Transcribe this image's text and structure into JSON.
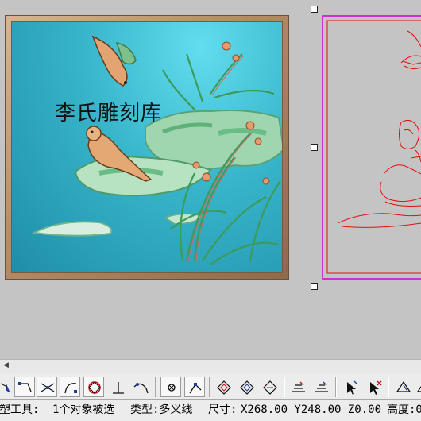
{
  "canvas": {
    "watermark": "李氏雕刻库"
  },
  "toolbar": {
    "tools": [
      {
        "name": "partial-arrow-tool",
        "icon": "arrow-icon"
      },
      {
        "name": "polyline-tool",
        "icon": "polyline-icon"
      },
      {
        "name": "trim-tool",
        "icon": "cross-lines-icon"
      },
      {
        "name": "arc-tool",
        "icon": "arc-icon"
      },
      {
        "name": "circle-tool",
        "icon": "circle-diamond-icon"
      },
      {
        "name": "perpendicular-tool",
        "icon": "perpendicular-icon"
      },
      {
        "name": "curve-tool",
        "icon": "curve-icon"
      },
      {
        "name": "node-tool",
        "icon": "node-box-icon"
      },
      {
        "name": "vertex-tool",
        "icon": "vertex-icon"
      },
      {
        "name": "offset-tool-1",
        "icon": "diamond-icon"
      },
      {
        "name": "offset-tool-2",
        "icon": "diamond-icon"
      },
      {
        "name": "offset-tool-3",
        "icon": "diamond-icon"
      },
      {
        "name": "layer-tool-1",
        "icon": "layers-icon"
      },
      {
        "name": "layer-tool-2",
        "icon": "layers-icon"
      },
      {
        "name": "select-tool",
        "icon": "cursor-icon"
      },
      {
        "name": "delete-select-tool",
        "icon": "cursor-x-icon"
      },
      {
        "name": "shape-tool-1",
        "icon": "shape-icon"
      },
      {
        "name": "shape-tool-2",
        "icon": "shape-icon"
      }
    ]
  },
  "status": {
    "tool": "塑工具:",
    "selection": "1个对象被选",
    "type": "类型:多义线",
    "size_label": "尺寸:",
    "size": "X268.00 Y248.00 Z0.00",
    "height": "高度:0"
  },
  "colors": {
    "relief_bg": "#37b4c9",
    "frame": "#b88e67",
    "vector_line": "#e01010",
    "selection_box": "#d000d0"
  }
}
